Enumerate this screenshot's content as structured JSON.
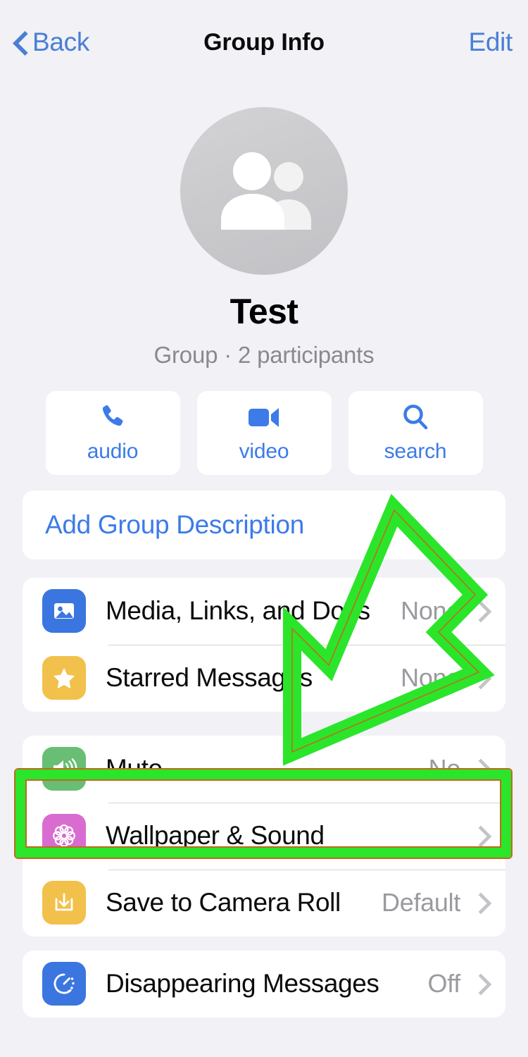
{
  "nav": {
    "back_label": "Back",
    "title": "Group Info",
    "edit_label": "Edit",
    "back_icon": "chevron-left-icon",
    "accent_color": "#4A7FD4"
  },
  "header": {
    "avatar_icon": "group-people-icon",
    "group_name": "Test",
    "subtitle": "Group · 2 participants"
  },
  "actions": [
    {
      "label": "audio",
      "icon": "phone-icon"
    },
    {
      "label": "video",
      "icon": "video-camera-icon"
    },
    {
      "label": "search",
      "icon": "search-icon"
    }
  ],
  "description": {
    "label": "Add Group Description"
  },
  "groups": [
    {
      "rows": [
        {
          "label": "Media, Links, and Docs",
          "value": "None",
          "icon": "photo-icon",
          "icon_color": "#3B76E0"
        },
        {
          "label": "Starred Messages",
          "value": "None",
          "icon": "star-icon",
          "icon_color": "#F2C14B"
        }
      ]
    },
    {
      "rows": [
        {
          "label": "Mute",
          "value": "No",
          "icon": "speaker-wave-icon",
          "icon_color": "#68BE72"
        },
        {
          "label": "Wallpaper & Sound",
          "value": "",
          "icon": "flower-icon",
          "icon_color": "#D96CD0"
        },
        {
          "label": "Save to Camera Roll",
          "value": "Default",
          "icon": "download-tray-icon",
          "icon_color": "#F2C14B"
        }
      ]
    },
    {
      "rows": [
        {
          "label": "Disappearing Messages",
          "value": "Off",
          "icon": "timer-icon",
          "icon_color": "#3B76E0"
        }
      ]
    }
  ],
  "annotations": {
    "highlight_color": "#2BE52B",
    "highlight_outline_color": "#C06A1E",
    "highlight_target": "Mute",
    "arrow_color": "#2BE52B",
    "arrow_direction": "down-left"
  }
}
